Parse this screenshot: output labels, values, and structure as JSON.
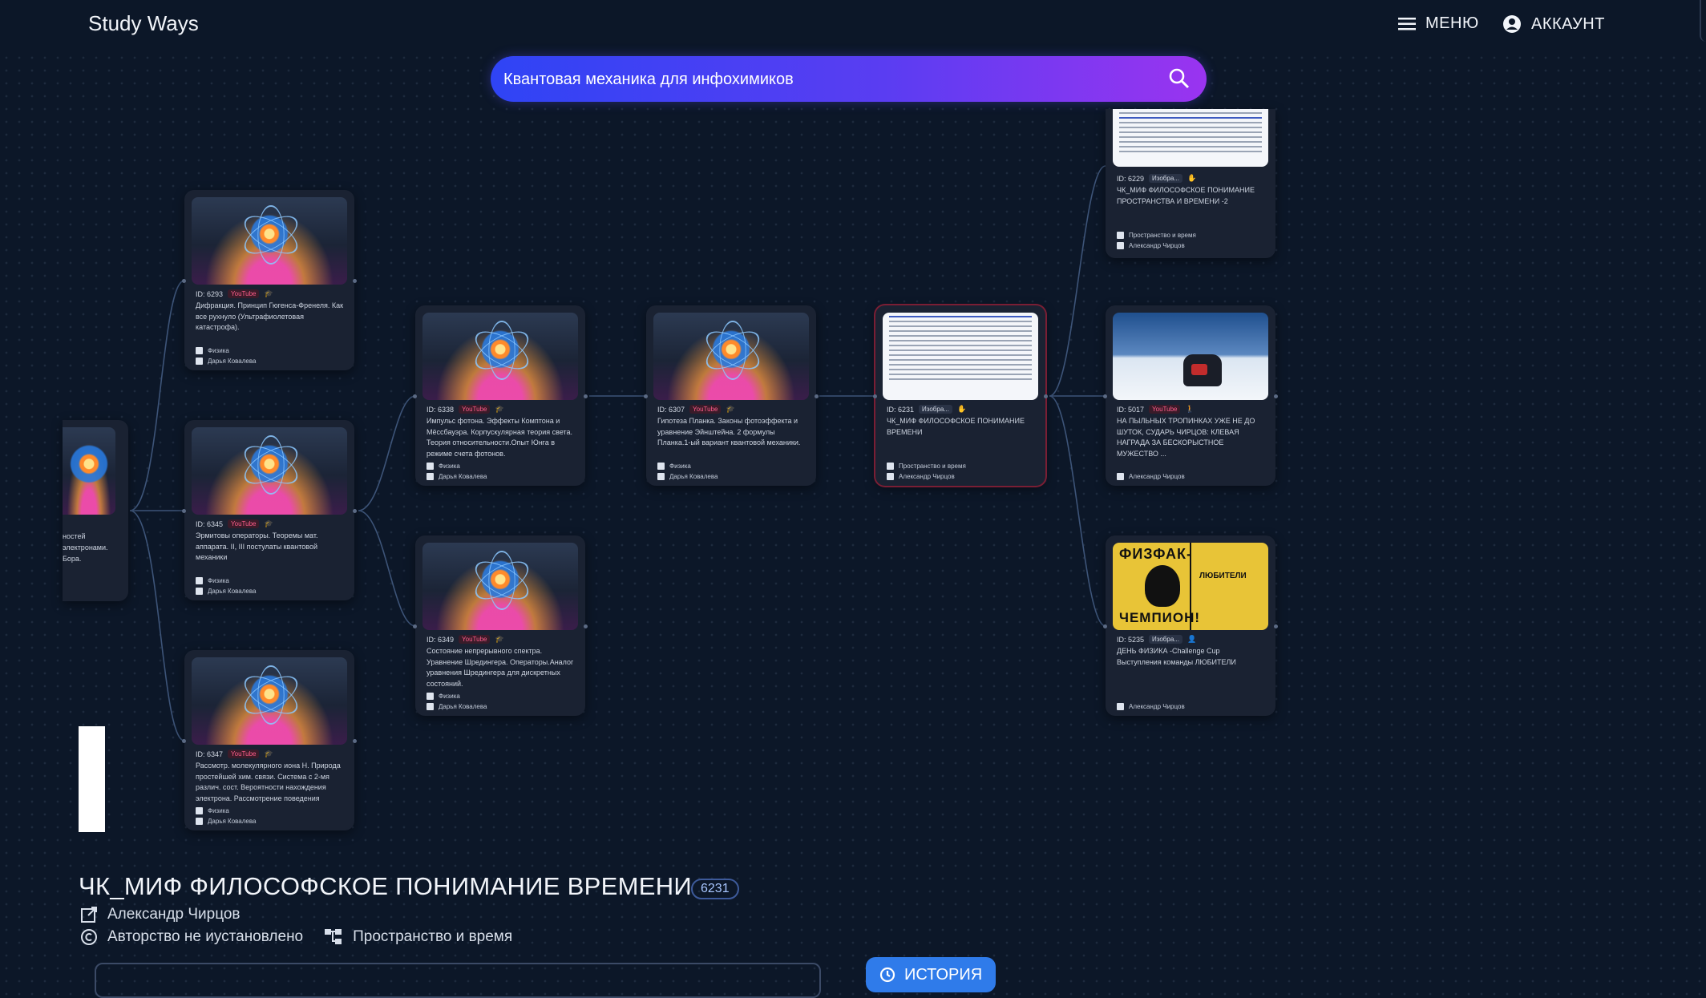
{
  "app": {
    "brand": "Study Ways",
    "menu_label": "МЕНЮ",
    "account_label": "АККАУНТ"
  },
  "search": {
    "value": "Квантовая механика для инфохимиков",
    "placeholder": ""
  },
  "theme": {
    "accent": "#2f7bea",
    "youtube_badge": "#ff5d8a",
    "selected_border": "#7a1e34"
  },
  "graph": {
    "cards": [
      {
        "id": "ID: 6293",
        "badge": "YouTube",
        "title": "Дифракция. Принцип Гюгенса-Френеля. Как все рухнуло (Ультрафиолетовая катастрофа).",
        "topic": "Физика",
        "author": "Дарья Ковалева",
        "thumb": "atom"
      },
      {
        "id": "ID: 6345",
        "badge": "YouTube",
        "title": "Эрмитовы операторы. Теоремы мат. аппарата. II, III постулаты квантовой механики",
        "topic": "Физика",
        "author": "Дарья Ковалева",
        "thumb": "atom"
      },
      {
        "id": "ID: 6347",
        "badge": "YouTube",
        "title": "Рассмотр. молекулярного иона H. Природа простейшей хим. связи. Система с 2-мя различ. сост. Вероятности нахождения электрона. Рассмотрение поведения",
        "topic": "Физика",
        "author": "Дарья Ковалева",
        "thumb": "atom"
      },
      {
        "id": "ID: 6338",
        "badge": "YouTube",
        "title": "Импульс фотона. Эффекты Комптона и Мёссбауэра. Корпускулярная теория света. Теория относительности.Опыт Юнга в режиме счета фотонов.",
        "topic": "Физика",
        "author": "Дарья Ковалева",
        "thumb": "atom"
      },
      {
        "id": "ID: 6349",
        "badge": "YouTube",
        "title": "Состояние непрерывного спектра. Уравнение Шредингера. Операторы.Аналог уравнения Шредингера для дискретных состояний.",
        "topic": "Физика",
        "author": "Дарья Ковалева",
        "thumb": "atom"
      },
      {
        "id": "ID: 6307",
        "badge": "YouTube",
        "title": "Гипотеза Планка. Законы фотоэффекта и уравнение Эйнштейна. 2 формулы Планка.1-ый вариант квантовой механики.",
        "topic": "Физика",
        "author": "Дарья Ковалева",
        "thumb": "atom"
      },
      {
        "id": "ID: 6231",
        "badge": "Изобра...",
        "title": "ЧК_МИФ ФИЛОСОФСКОЕ ПОНИМАНИЕ ВРЕМЕНИ",
        "topic": "Пространство и время",
        "author": "Александр Чирцов",
        "thumb": "doc"
      },
      {
        "id": "ID: 6229",
        "badge": "Изобра...",
        "title": "ЧК_МИФ ФИЛОСОФСКОЕ ПОНИМАНИЕ ПРОСТРАНСТВА И ВРЕМЕНИ -2",
        "topic": "Пространство и время",
        "author": "Александр Чирцов",
        "thumb": "doc"
      },
      {
        "id": "ID: 5017",
        "badge": "YouTube",
        "title": "НА ПЫЛЬНЫХ ТРОПИНКАХ УЖЕ НЕ ДО ШУТОК, СУДАРЬ ЧИРЦОВ: КЛЕВАЯ НАГРАДА ЗА БЕСКОРЫСТНОЕ МУЖЕСТВО ...",
        "topic": "",
        "author": "Александр Чирцов",
        "thumb": "snow"
      },
      {
        "id": "ID: 5235",
        "badge": "Изобра...",
        "title": "ДЕНЬ ФИЗИКА -Challenge Cup Выступления команды ЛЮБИТЕЛИ",
        "topic": "",
        "author": "Александр Чирцов",
        "thumb": "fizfak"
      }
    ],
    "partial_card_text": "ностей\nэлектронами.\nБора.",
    "fizfak_text": {
      "top": "ФИЗФАК-",
      "bottom": "ЧЕМПИОН!",
      "side": "ЛЮБИТЕЛИ"
    }
  },
  "detail": {
    "title": "ЧК_МИФ ФИЛОСОФСКОЕ ПОНИМАНИЕ ВРЕМЕНИ",
    "id": "6231",
    "author": "Александр Чирцов",
    "copyright": "Авторство не иустановлено",
    "topic": "Пространство и время",
    "history_label": "ИСТОРИЯ"
  }
}
